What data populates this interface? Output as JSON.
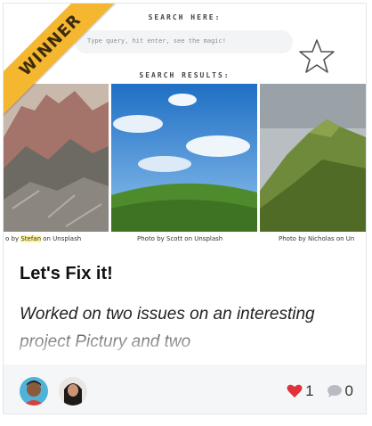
{
  "preview": {
    "search_heading": "SEARCH HERE:",
    "search_placeholder": "Type query, hit enter, see the magic!",
    "results_heading": "SEARCH RESULTS:",
    "credits": [
      {
        "prefix": "o by ",
        "name": "Stefan",
        "suffix": " on Unsplash"
      },
      {
        "text": "Photo by Scott on Unsplash"
      },
      {
        "text": "Photo by Nicholas on Un"
      }
    ]
  },
  "badge": {
    "label": "WINNER"
  },
  "post": {
    "title": "Let's Fix it!",
    "description": "Worked on two issues on an interesting project Pictury and two"
  },
  "footer": {
    "likes": "1",
    "comments": "0"
  },
  "colors": {
    "badge": "#f5b630",
    "heart": "#e0323c",
    "comment": "#b8bcc2",
    "footer_bg": "#f5f6f7"
  }
}
